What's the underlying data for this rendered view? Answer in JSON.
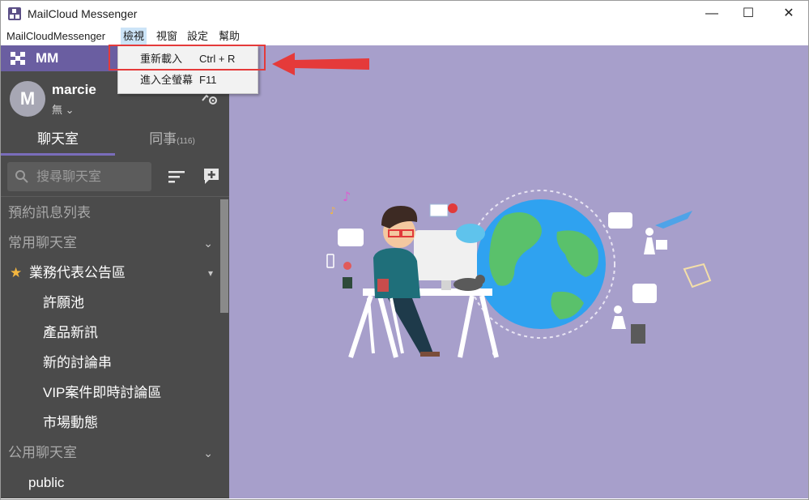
{
  "window": {
    "title": "MailCloud Messenger",
    "controls": {
      "minimize": "—",
      "maximize": "☐",
      "close": "✕"
    }
  },
  "menubar": {
    "items": [
      {
        "label": "MailCloudMessenger"
      },
      {
        "label": "檢視",
        "active": true
      },
      {
        "label": "視窗"
      },
      {
        "label": "設定"
      },
      {
        "label": "幫助"
      }
    ]
  },
  "view_menu": {
    "items": [
      {
        "label": "重新載入",
        "shortcut": "Ctrl + R"
      },
      {
        "label": "進入全螢幕",
        "shortcut": "F11"
      }
    ]
  },
  "sidebar": {
    "team_name": "MM",
    "user": {
      "avatar_letter": "M",
      "name": "marcie",
      "status": "無 ⌄"
    },
    "tabs": [
      {
        "label": "聊天室",
        "active": true
      },
      {
        "label": "同事",
        "count": "(116)"
      }
    ],
    "search": {
      "placeholder": "搜尋聊天室"
    },
    "sections": {
      "scheduled": "預約訊息列表",
      "favorites": "常用聊天室",
      "public": "公用聊天室"
    },
    "favorite_group": {
      "label": "業務代表公告區",
      "chevron": "▾"
    },
    "channels": [
      "許願池",
      "產品新訊",
      "新的討論串",
      "VIP案件即時討論區",
      "市場動態"
    ],
    "public_channels": [
      "public"
    ],
    "collapse_glyph": "⌄"
  },
  "colors": {
    "sidebar_bg": "#4b4b4b",
    "team_bar": "#6a5ea1",
    "main_bg": "#a79fcb",
    "highlight": "#e53a3a"
  },
  "icons": [
    "app-icon",
    "team-icon",
    "settings-icon",
    "search-icon",
    "sort-icon",
    "add-chat-icon",
    "star-icon",
    "chevron-icon",
    "arrow-icon"
  ]
}
